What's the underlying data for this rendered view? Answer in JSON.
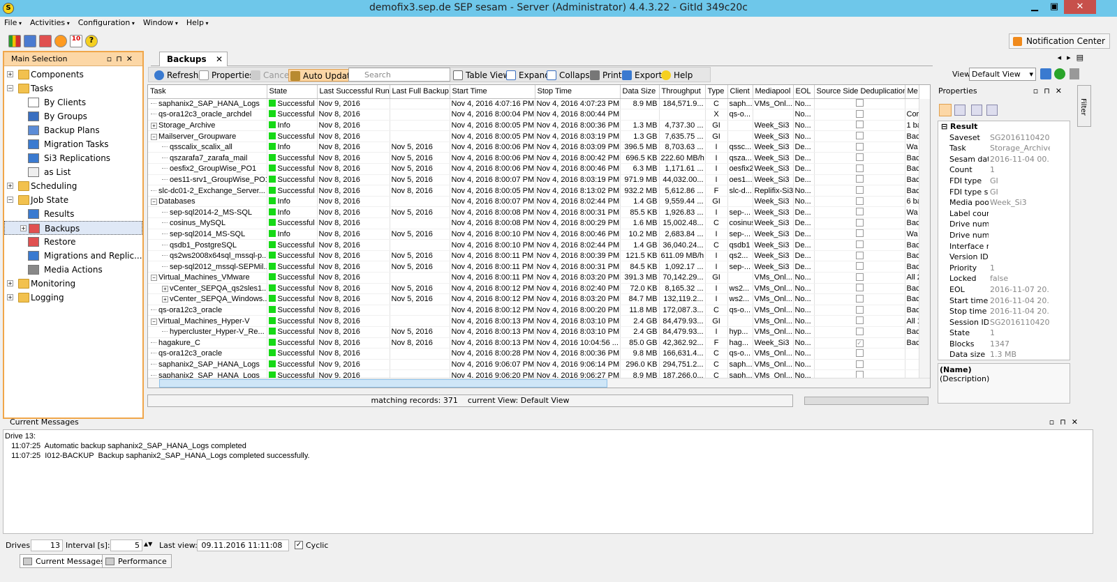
{
  "window": {
    "title": "demofix3.sep.de SEP sesam - Server (Administrator) 4.4.3.22  - GitId 349c20c",
    "minimize": "▁",
    "maximize": "▣",
    "close": "✕"
  },
  "menubar": [
    "File",
    "Activities",
    "Configuration",
    "Window",
    "Help"
  ],
  "notification_center": "Notification Center",
  "left_panel": {
    "title": "Main Selection",
    "tree": [
      {
        "label": "Components",
        "level": 0,
        "exp": "+",
        "icon": "folder"
      },
      {
        "label": "Tasks",
        "level": 0,
        "exp": "−",
        "icon": "folder"
      },
      {
        "label": "By Clients",
        "level": 1,
        "icon": "clients"
      },
      {
        "label": "By Groups",
        "level": 1,
        "icon": "groups"
      },
      {
        "label": "Backup Plans",
        "level": 1,
        "icon": "plans"
      },
      {
        "label": "Migration Tasks",
        "level": 1,
        "icon": "migration"
      },
      {
        "label": "Si3 Replications",
        "level": 1,
        "icon": "replication"
      },
      {
        "label": "as List",
        "level": 1,
        "icon": "list"
      },
      {
        "label": "Scheduling",
        "level": 0,
        "exp": "+",
        "icon": "folder"
      },
      {
        "label": "Job State",
        "level": 0,
        "exp": "−",
        "icon": "folder"
      },
      {
        "label": "Results",
        "level": 1,
        "icon": "results"
      },
      {
        "label": "Backups",
        "level": 1,
        "exp": "+",
        "icon": "backups",
        "selected": true
      },
      {
        "label": "Restore",
        "level": 1,
        "icon": "restore"
      },
      {
        "label": "Migrations and Replic...",
        "level": 1,
        "icon": "migrations"
      },
      {
        "label": "Media Actions",
        "level": 1,
        "icon": "media"
      },
      {
        "label": "Monitoring",
        "level": 0,
        "exp": "+",
        "icon": "folder"
      },
      {
        "label": "Logging",
        "level": 0,
        "exp": "+",
        "icon": "folder"
      }
    ]
  },
  "tab": {
    "label": "Backups",
    "close": "✕"
  },
  "toolbar": {
    "refresh": "Refresh",
    "properties": "Properties",
    "cancel": "Cancel",
    "auto_update": "Auto Update",
    "search_placeholder": "Search",
    "table_view": "Table View",
    "expand": "Expand",
    "collapse": "Collapse",
    "print": "Print",
    "export": "Export",
    "help": "Help"
  },
  "view": {
    "label": "View",
    "selected": "Default View"
  },
  "table": {
    "columns": [
      "Task",
      "State",
      "Last Successful Run",
      "Last Full Backup",
      "Start Time",
      "Stop Time",
      "Data Size",
      "Throughput",
      "Type",
      "Client",
      "Mediapool",
      "EOL",
      "Source Side Deduplication",
      "Me"
    ],
    "rows": [
      {
        "task": "saphanix2_SAP_HANA_Logs",
        "ind": 0,
        "tog": "",
        "state": "Successful",
        "last": "Nov 9, 2016",
        "full": "",
        "start": "Nov 4, 2016 4:07:16 PM",
        "stop": "Nov 4, 2016 4:07:23 PM",
        "size": "8.9 MB",
        "thr": "184,571.9...",
        "type": "C",
        "client": "saph...",
        "pool": "VMs_Onl...",
        "eol": "No...",
        "dedup": false,
        "me": ""
      },
      {
        "task": "qs-ora12c3_oracle_archdel",
        "ind": 0,
        "tog": "",
        "state": "Successful",
        "last": "Nov 8, 2016",
        "full": "",
        "start": "Nov 4, 2016 8:00:04 PM",
        "stop": "Nov 4, 2016 8:00:44 PM",
        "size": "",
        "thr": "",
        "type": "X",
        "client": "qs-o...",
        "pool": "",
        "eol": "No...",
        "dedup": false,
        "me": "Cor"
      },
      {
        "task": "Storage_Archive",
        "ind": 0,
        "tog": "+",
        "state": "Info",
        "last": "Nov 8, 2016",
        "full": "",
        "start": "Nov 4, 2016 8:00:05 PM",
        "stop": "Nov 4, 2016 8:00:36 PM",
        "size": "1.3 MB",
        "thr": "4,737.30 ...",
        "type": "GI",
        "client": "",
        "pool": "Week_Si3",
        "eol": "No...",
        "dedup": false,
        "me": "1 ba"
      },
      {
        "task": "Mailserver_Groupware",
        "ind": 0,
        "tog": "−",
        "state": "Successful",
        "last": "Nov 8, 2016",
        "full": "",
        "start": "Nov 4, 2016 8:00:05 PM",
        "stop": "Nov 4, 2016 8:03:19 PM",
        "size": "1.3 GB",
        "thr": "7,635.75 ...",
        "type": "GI",
        "client": "",
        "pool": "Week_Si3",
        "eol": "No...",
        "dedup": false,
        "me": "Bac"
      },
      {
        "task": "qsscalix_scalix_all",
        "ind": 1,
        "tog": "",
        "state": "Info",
        "last": "Nov 8, 2016",
        "full": "Nov 5, 2016",
        "start": "Nov 4, 2016 8:00:06 PM",
        "stop": "Nov 4, 2016 8:03:09 PM",
        "size": "396.5 MB",
        "thr": "8,703.63 ...",
        "type": "I",
        "client": "qssc...",
        "pool": "Week_Si3",
        "eol": "De...",
        "dedup": false,
        "me": "Wa"
      },
      {
        "task": "qszarafa7_zarafa_mail",
        "ind": 1,
        "tog": "",
        "state": "Successful",
        "last": "Nov 8, 2016",
        "full": "Nov 5, 2016",
        "start": "Nov 4, 2016 8:00:06 PM",
        "stop": "Nov 4, 2016 8:00:42 PM",
        "size": "696.5 KB",
        "thr": "222.60 MB/h",
        "type": "I",
        "client": "qsza...",
        "pool": "Week_Si3",
        "eol": "De...",
        "dedup": false,
        "me": "Bac"
      },
      {
        "task": "oesfix2_GroupWise_PO1",
        "ind": 1,
        "tog": "",
        "state": "Successful",
        "last": "Nov 8, 2016",
        "full": "Nov 5, 2016",
        "start": "Nov 4, 2016 8:00:06 PM",
        "stop": "Nov 4, 2016 8:00:46 PM",
        "size": "6.3 MB",
        "thr": "1,171.61 ...",
        "type": "I",
        "client": "oesfix2",
        "pool": "Week_Si3",
        "eol": "De...",
        "dedup": false,
        "me": "Bac"
      },
      {
        "task": "oes11-srv1_GroupWise_PO1",
        "ind": 1,
        "tog": "",
        "state": "Successful",
        "last": "Nov 8, 2016",
        "full": "Nov 5, 2016",
        "start": "Nov 4, 2016 8:00:07 PM",
        "stop": "Nov 4, 2016 8:03:19 PM",
        "size": "971.9 MB",
        "thr": "44,032.00...",
        "type": "I",
        "client": "oes1...",
        "pool": "Week_Si3",
        "eol": "De...",
        "dedup": false,
        "me": "Bac"
      },
      {
        "task": "slc-dc01-2_Exchange_Server...",
        "ind": 0,
        "tog": "",
        "state": "Successful",
        "last": "Nov 8, 2016",
        "full": "Nov 8, 2016",
        "start": "Nov 4, 2016 8:00:05 PM",
        "stop": "Nov 4, 2016 8:13:02 PM",
        "size": "932.2 MB",
        "thr": "5,612.86 ...",
        "type": "F",
        "client": "slc-d...",
        "pool": "Replifix-Si3",
        "eol": "No...",
        "dedup": false,
        "me": "Bac"
      },
      {
        "task": "Databases",
        "ind": 0,
        "tog": "−",
        "state": "Info",
        "last": "Nov 8, 2016",
        "full": "",
        "start": "Nov 4, 2016 8:00:07 PM",
        "stop": "Nov 4, 2016 8:02:44 PM",
        "size": "1.4 GB",
        "thr": "9,559.44 ...",
        "type": "GI",
        "client": "",
        "pool": "Week_Si3",
        "eol": "No...",
        "dedup": false,
        "me": "6 ba"
      },
      {
        "task": "sep-sql2014-2_MS-SQL",
        "ind": 1,
        "tog": "",
        "state": "Info",
        "last": "Nov 8, 2016",
        "full": "Nov 5, 2016",
        "start": "Nov 4, 2016 8:00:08 PM",
        "stop": "Nov 4, 2016 8:00:31 PM",
        "size": "85.5 KB",
        "thr": "1,926.83 ...",
        "type": "I",
        "client": "sep-...",
        "pool": "Week_Si3",
        "eol": "De...",
        "dedup": false,
        "me": "Wa"
      },
      {
        "task": "cosinus_MySQL",
        "ind": 1,
        "tog": "",
        "state": "Successful",
        "last": "Nov 8, 2016",
        "full": "",
        "start": "Nov 4, 2016 8:00:08 PM",
        "stop": "Nov 4, 2016 8:00:29 PM",
        "size": "1.6 MB",
        "thr": "15,002.48...",
        "type": "C",
        "client": "cosinus",
        "pool": "Week_Si3",
        "eol": "De...",
        "dedup": false,
        "me": "Bac"
      },
      {
        "task": "sep-sql2014_MS-SQL",
        "ind": 1,
        "tog": "",
        "state": "Info",
        "last": "Nov 8, 2016",
        "full": "Nov 5, 2016",
        "start": "Nov 4, 2016 8:00:10 PM",
        "stop": "Nov 4, 2016 8:00:46 PM",
        "size": "10.2 MB",
        "thr": "2,683.84 ...",
        "type": "I",
        "client": "sep-...",
        "pool": "Week_Si3",
        "eol": "De...",
        "dedup": false,
        "me": "Wa"
      },
      {
        "task": "qsdb1_PostgreSQL",
        "ind": 1,
        "tog": "",
        "state": "Successful",
        "last": "Nov 8, 2016",
        "full": "",
        "start": "Nov 4, 2016 8:00:10 PM",
        "stop": "Nov 4, 2016 8:02:44 PM",
        "size": "1.4 GB",
        "thr": "36,040.24...",
        "type": "C",
        "client": "qsdb1",
        "pool": "Week_Si3",
        "eol": "De...",
        "dedup": false,
        "me": "Bac"
      },
      {
        "task": "qs2ws2008x64sql_mssql-p...",
        "ind": 1,
        "tog": "",
        "state": "Successful",
        "last": "Nov 8, 2016",
        "full": "Nov 5, 2016",
        "start": "Nov 4, 2016 8:00:11 PM",
        "stop": "Nov 4, 2016 8:00:39 PM",
        "size": "121.5 KB",
        "thr": "611.09 MB/h",
        "type": "I",
        "client": "qs2...",
        "pool": "Week_Si3",
        "eol": "De...",
        "dedup": false,
        "me": "Bac"
      },
      {
        "task": "sep-sql2012_mssql-SEPMil...",
        "ind": 1,
        "tog": "",
        "state": "Successful",
        "last": "Nov 8, 2016",
        "full": "Nov 5, 2016",
        "start": "Nov 4, 2016 8:00:11 PM",
        "stop": "Nov 4, 2016 8:00:31 PM",
        "size": "84.5 KB",
        "thr": "1,092.17 ...",
        "type": "I",
        "client": "sep-...",
        "pool": "Week_Si3",
        "eol": "De...",
        "dedup": false,
        "me": "Bac"
      },
      {
        "task": "Virtual_Machines_VMware",
        "ind": 0,
        "tog": "−",
        "state": "Successful",
        "last": "Nov 8, 2016",
        "full": "",
        "start": "Nov 4, 2016 8:00:11 PM",
        "stop": "Nov 4, 2016 8:03:20 PM",
        "size": "391.3 MB",
        "thr": "70,142.29...",
        "type": "GI",
        "client": "",
        "pool": "VMs_Onl...",
        "eol": "No...",
        "dedup": false,
        "me": "All 2"
      },
      {
        "task": "vCenter_SEPQA_qs2sles1...",
        "ind": 1,
        "tog": "+",
        "state": "Successful",
        "last": "Nov 8, 2016",
        "full": "Nov 5, 2016",
        "start": "Nov 4, 2016 8:00:12 PM",
        "stop": "Nov 4, 2016 8:02:40 PM",
        "size": "72.0 KB",
        "thr": "8,165.32 ...",
        "type": "I",
        "client": "ws2...",
        "pool": "VMs_Onl...",
        "eol": "No...",
        "dedup": false,
        "me": "Bac"
      },
      {
        "task": "vCenter_SEPQA_Windows...",
        "ind": 1,
        "tog": "+",
        "state": "Successful",
        "last": "Nov 8, 2016",
        "full": "Nov 5, 2016",
        "start": "Nov 4, 2016 8:00:12 PM",
        "stop": "Nov 4, 2016 8:03:20 PM",
        "size": "84.7 MB",
        "thr": "132,119.2...",
        "type": "I",
        "client": "ws2...",
        "pool": "VMs_Onl...",
        "eol": "No...",
        "dedup": false,
        "me": "Bac"
      },
      {
        "task": "qs-ora12c3_oracle",
        "ind": 0,
        "tog": "",
        "state": "Successful",
        "last": "Nov 8, 2016",
        "full": "",
        "start": "Nov 4, 2016 8:00:12 PM",
        "stop": "Nov 4, 2016 8:00:20 PM",
        "size": "11.8 MB",
        "thr": "172,087.3...",
        "type": "C",
        "client": "qs-o...",
        "pool": "VMs_Onl...",
        "eol": "No...",
        "dedup": false,
        "me": "Bac"
      },
      {
        "task": "Virtual_Machines_Hyper-V",
        "ind": 0,
        "tog": "−",
        "state": "Successful",
        "last": "Nov 8, 2016",
        "full": "",
        "start": "Nov 4, 2016 8:00:13 PM",
        "stop": "Nov 4, 2016 8:03:10 PM",
        "size": "2.4 GB",
        "thr": "84,479.93...",
        "type": "GI",
        "client": "",
        "pool": "VMs_Onl...",
        "eol": "No...",
        "dedup": false,
        "me": "All 1"
      },
      {
        "task": "hypercluster_Hyper-V_Re...",
        "ind": 1,
        "tog": "",
        "state": "Successful",
        "last": "Nov 8, 2016",
        "full": "Nov 5, 2016",
        "start": "Nov 4, 2016 8:00:13 PM",
        "stop": "Nov 4, 2016 8:03:10 PM",
        "size": "2.4 GB",
        "thr": "84,479.93...",
        "type": "I",
        "client": "hyp...",
        "pool": "VMs_Onl...",
        "eol": "No...",
        "dedup": false,
        "me": "Bac"
      },
      {
        "task": "hagakure_C",
        "ind": 0,
        "tog": "",
        "state": "Successful",
        "last": "Nov 8, 2016",
        "full": "Nov 8, 2016",
        "start": "Nov 4, 2016 8:00:13 PM",
        "stop": "Nov 4, 2016 10:04:56 ...",
        "size": "85.0 GB",
        "thr": "42,362.92...",
        "type": "F",
        "client": "hag...",
        "pool": "Week_Si3",
        "eol": "No...",
        "dedup": true,
        "me": "Bac"
      },
      {
        "task": "qs-ora12c3_oracle",
        "ind": 0,
        "tog": "",
        "state": "Successful",
        "last": "Nov 8, 2016",
        "full": "",
        "start": "Nov 4, 2016 8:00:28 PM",
        "stop": "Nov 4, 2016 8:00:36 PM",
        "size": "9.8 MB",
        "thr": "166,631.4...",
        "type": "C",
        "client": "qs-o...",
        "pool": "VMs_Onl...",
        "eol": "No...",
        "dedup": false,
        "me": ""
      },
      {
        "task": "saphanix2_SAP_HANA_Logs",
        "ind": 0,
        "tog": "",
        "state": "Successful",
        "last": "Nov 9, 2016",
        "full": "",
        "start": "Nov 4, 2016 9:06:07 PM",
        "stop": "Nov 4, 2016 9:06:14 PM",
        "size": "296.0 KB",
        "thr": "294,751.2...",
        "type": "C",
        "client": "saph...",
        "pool": "VMs_Onl...",
        "eol": "No...",
        "dedup": false,
        "me": ""
      },
      {
        "task": "saphanix2_SAP_HANA_Logs",
        "ind": 0,
        "tog": "",
        "state": "Successful",
        "last": "Nov 9, 2016",
        "full": "",
        "start": "Nov 4, 2016 9:06:20 PM",
        "stop": "Nov 4, 2016 9:06:27 PM",
        "size": "8.9 MB",
        "thr": "187,266.0...",
        "type": "C",
        "client": "saph...",
        "pool": "VMs_Onl...",
        "eol": "No...",
        "dedup": false,
        "me": ""
      }
    ]
  },
  "status": {
    "matching": "matching records: 371",
    "view": "current View: Default View"
  },
  "properties": {
    "title": "Properties",
    "group": "Result",
    "rows": [
      {
        "k": "Saveset",
        "v": "SG2016110420..."
      },
      {
        "k": "Task",
        "v": "Storage_Archive"
      },
      {
        "k": "Sesam date",
        "v": "2016-11-04 00..."
      },
      {
        "k": "Count",
        "v": "1"
      },
      {
        "k": "FDI type",
        "v": "GI"
      },
      {
        "k": "FDI type set",
        "v": "GI"
      },
      {
        "k": "Media pool",
        "v": "Week_Si3"
      },
      {
        "k": "Label count",
        "v": ""
      },
      {
        "k": "Drive number",
        "v": ""
      },
      {
        "k": "Drive numb...",
        "v": ""
      },
      {
        "k": "Interface n...",
        "v": ""
      },
      {
        "k": "Version ID",
        "v": ""
      },
      {
        "k": "Priority",
        "v": "1"
      },
      {
        "k": "Locked",
        "v": "false"
      },
      {
        "k": "EOL",
        "v": "2016-11-07 20..."
      },
      {
        "k": "Start time",
        "v": "2016-11-04 20..."
      },
      {
        "k": "Stop time",
        "v": "2016-11-04 20..."
      },
      {
        "k": "Session ID",
        "v": "SG2016110420..."
      },
      {
        "k": "State",
        "v": "1"
      },
      {
        "k": "Blocks",
        "v": "1347"
      },
      {
        "k": "Data size",
        "v": "1.3 MB"
      }
    ],
    "desc_name": "(Name)",
    "desc_text": "(Description)",
    "filter": "Filter"
  },
  "messages": {
    "title": "Current Messages",
    "lines": [
      "Drive 13:",
      "   11:07:25  Automatic backup saphanix2_SAP_HANA_Logs completed",
      "   11:07:25  I012-BACKUP  Backup saphanix2_SAP_HANA_Logs completed successfully."
    ]
  },
  "bottom": {
    "drives_label": "Drives",
    "drives": "13",
    "interval_label": "Interval [s]:",
    "interval": "5",
    "last_view_label": "Last view:",
    "last_view": "09.11.2016 11:11:08",
    "cyclic": "Cyclic"
  },
  "bottom_tabs": [
    "Current Messages",
    "Performance"
  ],
  "colors": {
    "title_bar": "#6ec7ea",
    "selection_orange": "#f0a64a",
    "status_green": "#16d916"
  }
}
